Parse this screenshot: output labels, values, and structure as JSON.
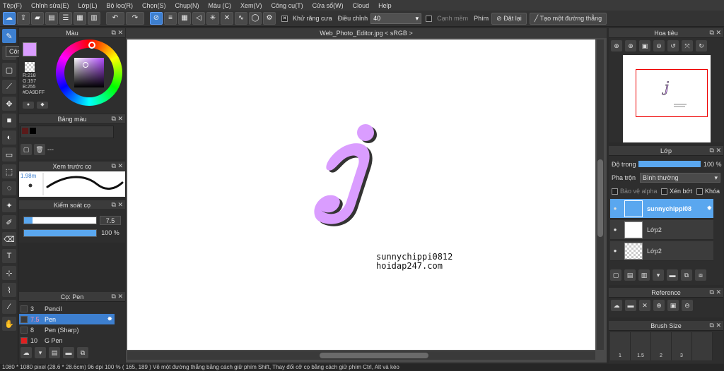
{
  "menu": [
    "Tệp(F)",
    "Chỉnh sửa(E)",
    "Lớp(L)",
    "Bộ lọc(R)",
    "Chọn(S)",
    "Chụp(N)",
    "Màu (C)",
    "Xem(V)",
    "Công cụ(T)",
    "Cửa sổ(W)",
    "Cloud",
    "Help"
  ],
  "toolbar": {
    "antialias_check": "✕",
    "antialias_label": "Khử răng cưa",
    "adjust_label": "Điều chỉnh",
    "adjust_value": "40",
    "edge_label": "Cạnh mềm",
    "pen_label": "Phím",
    "reset_label": "Đặt lại",
    "line_label": "Tạo một đường thẳng"
  },
  "tooltip": "Công cụ cọ",
  "color_panel": {
    "title": "Màu",
    "r": "R:218",
    "g": "G:157",
    "b": "B:255",
    "hex": "#DA9DFF",
    "current_color": "#DA9DFF"
  },
  "palette_panel": {
    "title": "Bảng màu",
    "dash": "---"
  },
  "brush_preview": {
    "title": "Xem trước cọ",
    "size": "1.98m"
  },
  "brush_control": {
    "title": "Kiểm soát cọ",
    "size_value": "7.5",
    "size_fill": 0.12,
    "opacity_value": "100 %",
    "opacity_fill": 1.0
  },
  "brush_list": {
    "title": "Cọ: Pen",
    "items": [
      {
        "size": "3",
        "name": "Pencil",
        "color": "#3a3a3a"
      },
      {
        "size": "7.5",
        "name": "Pen",
        "color": "#3a3a3a"
      },
      {
        "size": "8",
        "name": "Pen (Sharp)",
        "color": "#3a3a3a"
      },
      {
        "size": "10",
        "name": "G Pen",
        "color": "#e02020"
      }
    ]
  },
  "document": {
    "tab": "Web_Photo_Editor.jpg < sRGB >",
    "watermark_line1": "sunnychippi0812",
    "watermark_line2": "hoidap247.com"
  },
  "navigator": {
    "title": "Hoa tiêu"
  },
  "layer_panel": {
    "title": "Lớp",
    "opacity_label": "Độ trong",
    "opacity_value": "100 %",
    "opacity_fill": 1.0,
    "blend_label": "Pha trộn",
    "blend_value": "Bình thường",
    "protect_alpha": "Bảo vệ alpha",
    "clipping": "Xén bớt",
    "lock": "Khóa",
    "layers": [
      {
        "name": "sunnychippi08"
      },
      {
        "name": "Lớp2"
      },
      {
        "name": "Lớp2"
      }
    ]
  },
  "reference": {
    "title": "Reference"
  },
  "brush_size": {
    "title": "Brush Size",
    "values": [
      "1",
      "1.5",
      "2",
      "3"
    ]
  },
  "status": "1080 * 1080 pixel   (28.6 * 28.6cm)   96 dpi   100 %   ( 165, 189 )   Vẽ một đường thẳng bằng cách giữ phím Shift, Thay đổi cỡ cọ bằng cách giữ phím Ctrl, Alt và kéo",
  "colors": {
    "accent": "#3d7fcf",
    "brush_color": "#DA9DFF",
    "shadow": "#333333"
  }
}
